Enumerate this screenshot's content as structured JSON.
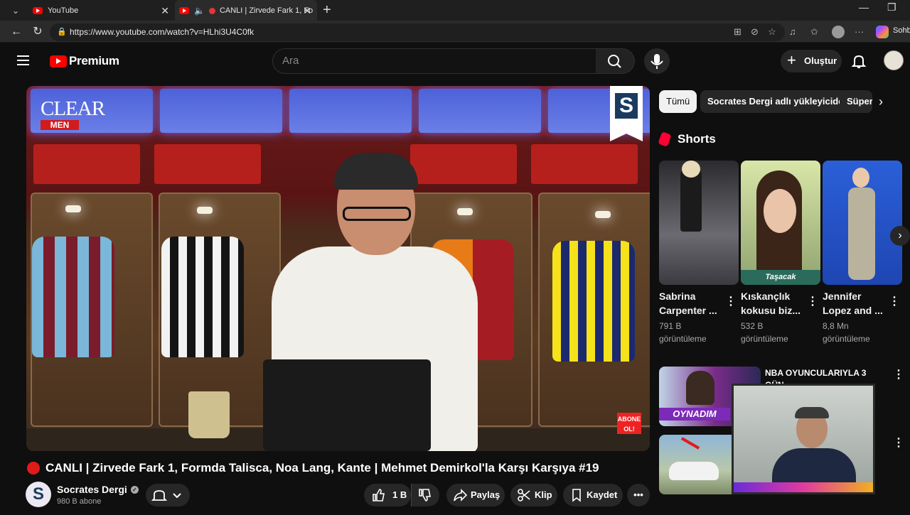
{
  "browser": {
    "tabs": [
      {
        "title": "YouTube"
      },
      {
        "title": "CANLI | Zirvede Fark 1, Fo"
      }
    ],
    "url": "https://www.youtube.com/watch?v=HLhi3U4C0fk",
    "sidebar_label": "Sohb"
  },
  "youtube": {
    "brand": "Premium",
    "search_placeholder": "Ara",
    "create_label": "Oluştur"
  },
  "video": {
    "overlay_brand": "CLEAR",
    "overlay_brand_sub": "MEN",
    "channel_badge_letter": "S",
    "corner_badge": "ABONE OL!",
    "title": "CANLI | Zirvede Fark 1, Formda Talisca, Noa Lang, Kante | Mehmet Demirkol'la Karşı Karşıya #19",
    "channel_name": "Socrates Dergi",
    "channel_avatar_letter": "S",
    "subscribers": "980 B abone",
    "like_count": "1 B",
    "share_label": "Paylaş",
    "clip_label": "Klip",
    "save_label": "Kaydet"
  },
  "chips": [
    {
      "label": "Tümü",
      "active": true
    },
    {
      "label": "Socrates Dergi adlı yükleyiciden",
      "active": false
    },
    {
      "label": "Süper",
      "active": false
    }
  ],
  "shorts": {
    "heading": "Shorts",
    "items": [
      {
        "title_line1": "Sabrina",
        "title_line2": "Carpenter ...",
        "views_line1": "791 B",
        "views_line2": "görüntüleme"
      },
      {
        "title_line1": "Kıskançlık",
        "title_line2": "kokusu biz...",
        "views_line1": "532 B",
        "views_line2": "görüntüleme",
        "caption": "Taşacak"
      },
      {
        "title_line1": "Jennifer",
        "title_line2": "Lopez and ...",
        "views_line1": "8,8 Mn",
        "views_line2": "görüntüleme"
      }
    ]
  },
  "related": [
    {
      "title": "NBA OYUNCULARIYLA 3 GÜN",
      "thumb_text": "OYNADIM"
    }
  ],
  "colors": {
    "youtube_red": "#ff0000",
    "background": "#0f0f0f",
    "chip_bg": "#272727"
  }
}
